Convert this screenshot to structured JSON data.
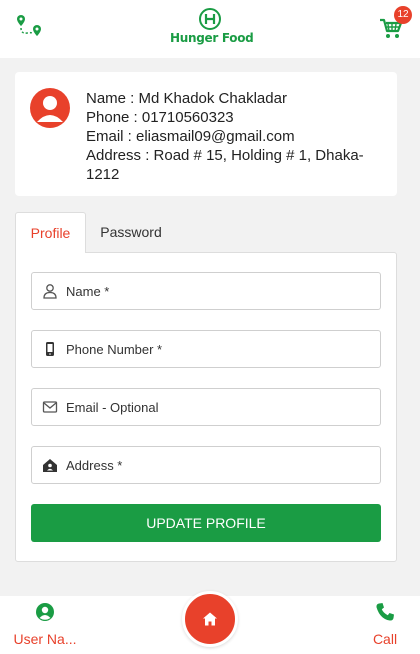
{
  "header": {
    "logo_text": "Hunger Food",
    "cart_count": "12",
    "route_icon": "route-pin-icon",
    "cart_icon": "cart-icon"
  },
  "profile": {
    "name_line": "Name : Md Khadok Chakladar",
    "phone_line": "Phone : 01710560323",
    "email_line": "Email : eliasmail09@gmail.com",
    "address_line": "Address : Road # 15, Holding # 1, Dhaka-1212"
  },
  "tabs": [
    {
      "label": "Profile",
      "active": true
    },
    {
      "label": "Password",
      "active": false
    }
  ],
  "form": {
    "name_placeholder": "Name *",
    "phone_placeholder": "Phone Number *",
    "email_placeholder": "Email - Optional",
    "address_placeholder": "Address *",
    "submit_label": "UPDATE PROFILE"
  },
  "bottom_nav": {
    "user_label": "User Na...",
    "call_label": "Call"
  },
  "colors": {
    "brand_green": "#1a9c44",
    "accent_red": "#e8412b"
  }
}
